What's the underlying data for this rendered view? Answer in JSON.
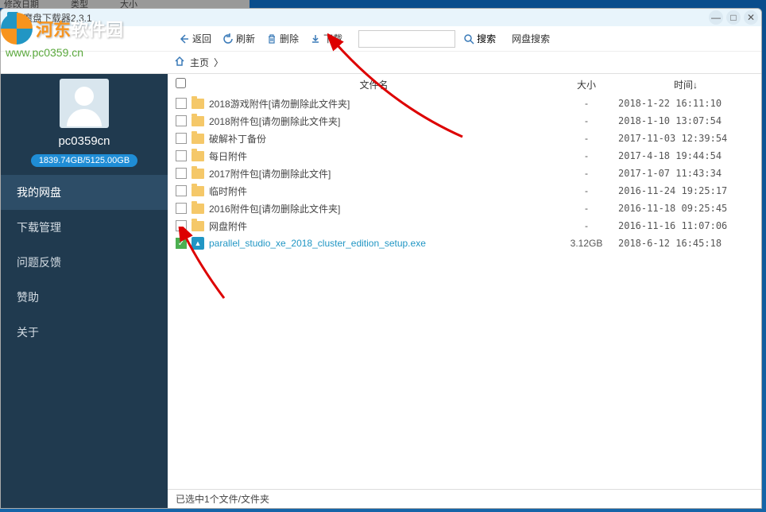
{
  "top_bar": {
    "col1": "修改日期",
    "col2": "类型",
    "col3": "大小"
  },
  "watermark": {
    "title_main": "河东",
    "title_rest": "软件园",
    "url": "www.pc0359.cn"
  },
  "window": {
    "title": "魔盘下载器2.3.1"
  },
  "toolbar": {
    "back": "返回",
    "refresh": "刷新",
    "delete": "删除",
    "download": "下载",
    "search": "搜索",
    "web_search": "网盘搜索",
    "search_placeholder": ""
  },
  "breadcrumb": {
    "home": "主页",
    "suffix": " 〉"
  },
  "user": {
    "name": "pc0359cn",
    "storage": "1839.74GB/5125.00GB"
  },
  "nav": {
    "items": [
      "我的网盘",
      "下载管理",
      "问题反馈",
      "赞助",
      "关于"
    ],
    "active_index": 0
  },
  "columns": {
    "name": "文件名",
    "size": "大小",
    "time": "时间↓"
  },
  "files": [
    {
      "checked": false,
      "type": "folder",
      "name": "2018游戏附件[请勿删除此文件夹]",
      "size": "-",
      "time": "2018-1-22 16:11:10"
    },
    {
      "checked": false,
      "type": "folder",
      "name": "2018附件包[请勿删除此文件夹]",
      "size": "-",
      "time": "2018-1-10 13:07:54"
    },
    {
      "checked": false,
      "type": "folder",
      "name": "破解补丁备份",
      "size": "-",
      "time": "2017-11-03 12:39:54"
    },
    {
      "checked": false,
      "type": "folder",
      "name": "每日附件",
      "size": "-",
      "time": "2017-4-18 19:44:54"
    },
    {
      "checked": false,
      "type": "folder",
      "name": "2017附件包[请勿删除此文件]",
      "size": "-",
      "time": "2017-1-07 11:43:34"
    },
    {
      "checked": false,
      "type": "folder",
      "name": "临时附件",
      "size": "-",
      "time": "2016-11-24 19:25:17"
    },
    {
      "checked": false,
      "type": "folder",
      "name": "2016附件包[请勿删除此文件夹]",
      "size": "-",
      "time": "2016-11-18 09:25:45"
    },
    {
      "checked": false,
      "type": "folder",
      "name": "网盘附件",
      "size": "-",
      "time": "2016-11-16 11:07:06"
    },
    {
      "checked": true,
      "type": "file",
      "name": "parallel_studio_xe_2018_cluster_edition_setup.exe",
      "size": "3.12GB",
      "time": "2018-6-12 16:45:18"
    }
  ],
  "status": "已选中1个文件/文件夹"
}
